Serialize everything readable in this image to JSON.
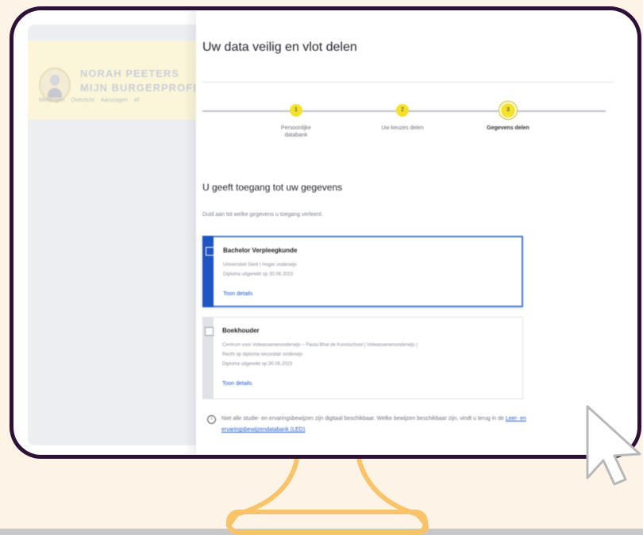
{
  "profile": {
    "name": "NORAH PEETERS",
    "subtitle": "MIJN BURGERPROFIEL",
    "nav": [
      "Meldingen",
      "Overzicht",
      "Aanvragen",
      "Af"
    ]
  },
  "dialog": {
    "title": "Uw data veilig en vlot delen",
    "steps": [
      {
        "number": "1",
        "label_line1": "Persoonlijke",
        "label_line2": "databank"
      },
      {
        "number": "2",
        "label_line1": "Uw keuzes delen",
        "label_line2": ""
      },
      {
        "number": "3",
        "label_line1": "Gegevens delen",
        "label_line2": ""
      }
    ],
    "current_step": 3,
    "section_title": "U geeft toegang tot uw gegevens",
    "intro": "Duid aan tot welke gegevens u toegang verleent.",
    "cards": [
      {
        "title": "Bachelor Verpleegkunde",
        "lines": [
          "Universiteit Gent | Hoger onderwijs",
          "Diploma uitgereikt op 30.06.2023"
        ],
        "link": "Toon details",
        "selected": true
      },
      {
        "title": "Boekhouder",
        "lines": [
          "Centrum voor Volwassenenonderwijs – Pasta Bhal de Kunstschool | Volwassenenonderwijs |",
          "Recht op diploma secundair onderwijs",
          "Diploma uitgereikt op 30.06.2023"
        ],
        "link": "Toon details",
        "selected": false
      }
    ],
    "info": {
      "text": "Niet alle studie- en ervaringsbewijzen zijn digitaal beschikbaar. Welke bewijzen beschikbaar zijn, vindt u terug in de",
      "link": "Leer- en ervaringsbewijzendatabank (LED)",
      "suffix": "."
    }
  },
  "colors": {
    "background": "#fdf3e7",
    "monitor_frame": "#2d1137",
    "stand": "#f9c36a",
    "accent_blue": "#1f54c4",
    "step_yellow": "#f4e12a"
  }
}
